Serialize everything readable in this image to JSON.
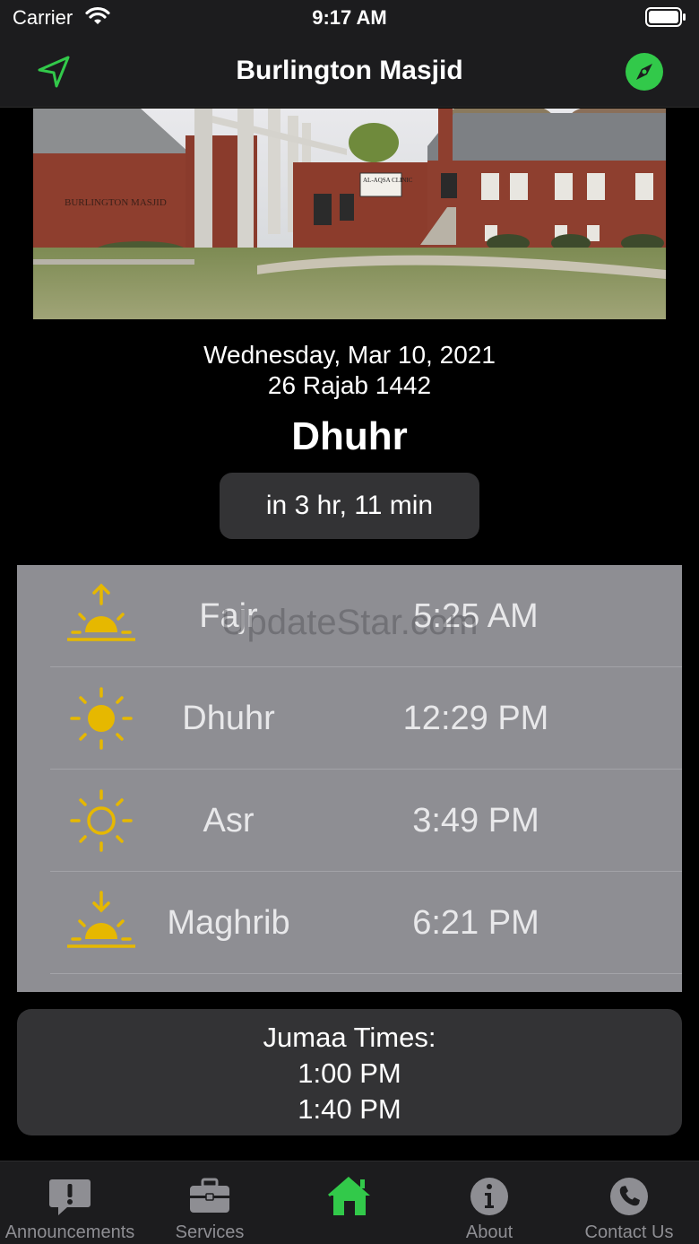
{
  "status_bar": {
    "carrier": "Carrier",
    "time": "9:17 AM"
  },
  "nav": {
    "title": "Burlington Masjid"
  },
  "hero": {
    "sign_text": "BURLINGTON MASJID",
    "clinic_sign": "AL-AQSA CLINIC"
  },
  "date": {
    "gregorian": "Wednesday, Mar 10, 2021",
    "hijri": "26 Rajab 1442"
  },
  "next_prayer": {
    "name": "Dhuhr",
    "countdown": "in 3 hr, 11 min"
  },
  "prayers": [
    {
      "name": "Fajr",
      "time": "5:25 AM",
      "icon": "sunrise-icon"
    },
    {
      "name": "Dhuhr",
      "time": "12:29 PM",
      "icon": "sun-icon"
    },
    {
      "name": "Asr",
      "time": "3:49 PM",
      "icon": "sun-outline-icon"
    },
    {
      "name": "Maghrib",
      "time": "6:21 PM",
      "icon": "sunset-icon"
    }
  ],
  "watermark": "UpdateStar.com",
  "jumaa": {
    "title": "Jumaa Times:",
    "times": [
      "1:00 PM",
      "1:40 PM"
    ]
  },
  "tabs": [
    {
      "label": "Announcements",
      "icon": "exclamation-bubble-icon",
      "active": false
    },
    {
      "label": "Services",
      "icon": "briefcase-icon",
      "active": false
    },
    {
      "label": "",
      "icon": "home-icon",
      "active": true
    },
    {
      "label": "About",
      "icon": "info-icon",
      "active": false
    },
    {
      "label": "Contact Us",
      "icon": "phone-icon",
      "active": false
    }
  ],
  "colors": {
    "accent": "#32c94a",
    "icon_yellow": "#e6b800",
    "table_bg": "#8e8e93",
    "card_bg": "#333335"
  }
}
